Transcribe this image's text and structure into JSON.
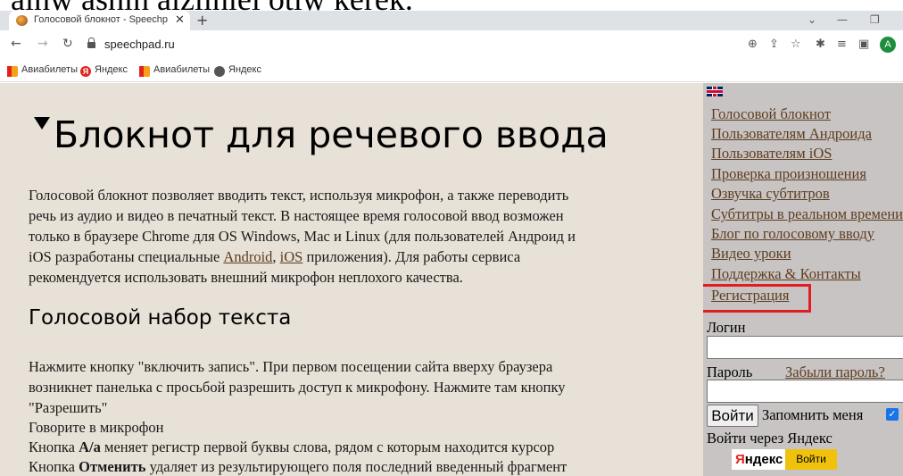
{
  "caption_cut": "ainw ashin aiziiniei otiw kerek.",
  "browser": {
    "tab_title": "Голосовой блокнот - Speechpad",
    "url": "speechpad.ru",
    "bookmarks": [
      "Авиабилеты",
      "Яндекс",
      "Авиабилеты",
      "Яндекс"
    ],
    "avatar_letter": "A"
  },
  "page": {
    "title": "Блокнот для речевого ввода",
    "intro_1": "Голосовой блокнот позволяет вводить текст, используя микрофон, а также переводить",
    "intro_2": "речь из аудио и видео в печатный текст. В настоящее время голосовой ввод возможен",
    "intro_3": "только в браузере Chrome для OS Windows, Mac и Linux (для пользователей Андроид и",
    "intro_4_pre": "iOS разработаны специальные ",
    "intro_link_android": "Android",
    "intro_4_sep": ", ",
    "intro_link_ios": "iOS",
    "intro_4_post": " приложения). Для работы сервиса",
    "intro_5": "рекомендуется использовать внешний микрофон неплохого качества.",
    "subtitle": "Голосовой набор текста",
    "body_1": "Нажмите кнопку \"включить запись\". При первом посещении сайта вверху браузера",
    "body_2": "возникнет панелька с просьбой разрешить доступ к микрофону. Нажмите там кнопку",
    "body_3": "\"Разрешить\"",
    "body_4": "Говорите в микрофон",
    "body_5_pre": "Кнопка ",
    "body_5_bold": "A/a",
    "body_5_post": " меняет регистр первой буквы слова, рядом с которым находится курсор",
    "body_6_pre": "Кнопка ",
    "body_6_bold": "Отменить",
    "body_6_post": " удаляет из результирующего поля последний введенный фрагмент"
  },
  "sidebar": {
    "nav": [
      "Голосовой блокнот",
      "Пользователям Андроида",
      "Пользователям iOS",
      "Проверка произношения",
      "Озвучка субтитров",
      "Субтитры в реальном времени",
      "Блог по голосовому вводу",
      "Видео уроки",
      "Поддержка & Контакты",
      "Регистрация"
    ],
    "login_label": "Логин",
    "password_label": "Пароль",
    "forgot_link": "Забыли пароль?",
    "login_button": "Войти",
    "remember_label": "Запомнить меня",
    "yandex_login_label": "Войти через Яндекс",
    "yandex_logo": "Яндекс",
    "yandex_button": "Войти"
  },
  "colors": {
    "page_bg": "#e8e1d7",
    "sidebar_bg": "#c9c4c4",
    "link": "#5c3d1e",
    "highlight": "#e11d24"
  }
}
